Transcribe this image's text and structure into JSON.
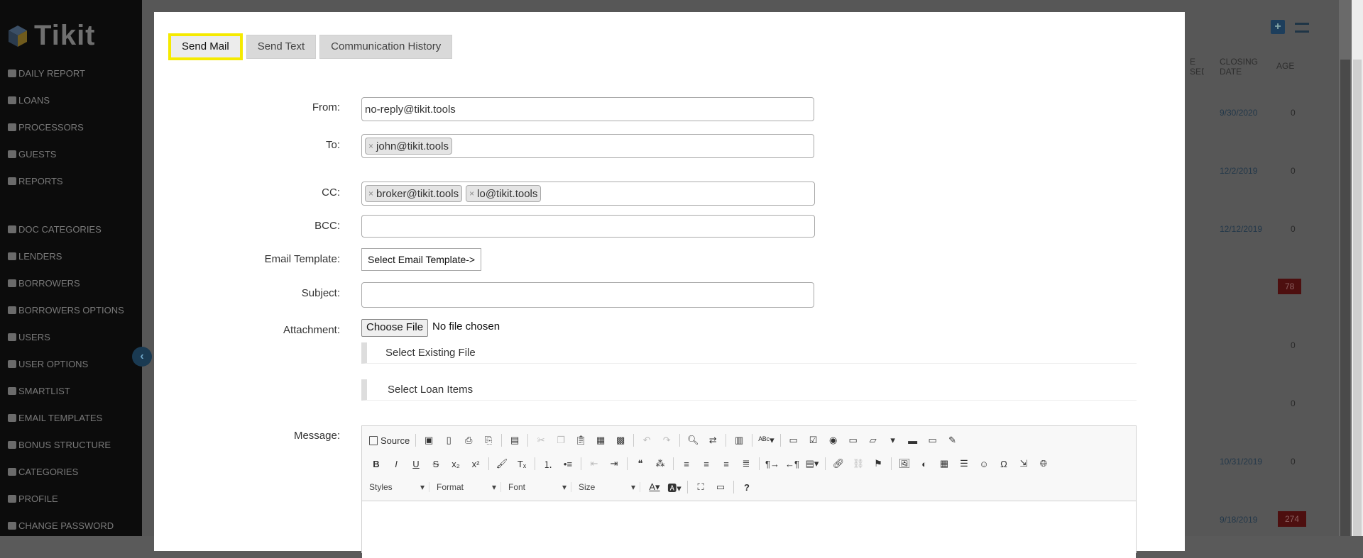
{
  "app": {
    "name": "Tikit"
  },
  "sidebar": {
    "items": [
      {
        "label": "DAILY REPORT",
        "icon": "list-icon"
      },
      {
        "label": "LOANS",
        "icon": "file-icon"
      },
      {
        "label": "PROCESSORS",
        "icon": "user-icon"
      },
      {
        "label": "GUESTS",
        "icon": "users-icon"
      },
      {
        "label": "REPORTS",
        "icon": "chart-icon"
      },
      {
        "label": "DOC CATEGORIES",
        "icon": "wrench-icon"
      },
      {
        "label": "LENDERS",
        "icon": "money-icon"
      },
      {
        "label": "BORROWERS",
        "icon": "home-icon"
      },
      {
        "label": "BORROWERS OPTIONS",
        "icon": "home-icon"
      },
      {
        "label": "USERS",
        "icon": "users-icon"
      },
      {
        "label": "USER OPTIONS",
        "icon": "user-tie-icon"
      },
      {
        "label": "SMARTLIST",
        "icon": "list-icon"
      },
      {
        "label": "EMAIL TEMPLATES",
        "icon": "envelope-icon"
      },
      {
        "label": "BONUS STRUCTURE",
        "icon": "money-icon"
      },
      {
        "label": "CATEGORIES",
        "icon": "wrench-icon"
      },
      {
        "label": "PROFILE",
        "icon": "user-icon"
      },
      {
        "label": "CHANGE PASSWORD",
        "icon": "key-icon"
      }
    ]
  },
  "background_table": {
    "headers": [
      "E SED",
      "CLOSING DATE",
      "AGE"
    ],
    "rows": [
      {
        "date": "9/30/2020",
        "age": "0"
      },
      {
        "date": "12/2/2019",
        "age": "0"
      },
      {
        "date": "12/12/2019",
        "age": "0"
      },
      {
        "date": "",
        "age": "78",
        "age_flag": "red"
      },
      {
        "date": "",
        "age": "0"
      },
      {
        "date": "",
        "age": "0"
      },
      {
        "date": "10/31/2019",
        "age": "0"
      },
      {
        "date": "9/18/2019",
        "age": "274",
        "age_flag": "red"
      }
    ]
  },
  "modal": {
    "tabs": [
      {
        "label": "Send Mail",
        "active": true
      },
      {
        "label": "Send Text",
        "active": false
      },
      {
        "label": "Communication History",
        "active": false
      }
    ],
    "form": {
      "from_label": "From:",
      "from_value": "no-reply@tikit.tools",
      "to_label": "To:",
      "to_chips": [
        "john@tikit.tools"
      ],
      "cc_label": "CC:",
      "cc_chips": [
        "broker@tikit.tools",
        "lo@tikit.tools"
      ],
      "bcc_label": "BCC:",
      "bcc_value": "",
      "template_label": "Email Template:",
      "template_value": "Select Email Template->",
      "subject_label": "Subject:",
      "subject_value": "",
      "attachment_label": "Attachment:",
      "choose_file": "Choose File",
      "no_file": "No file chosen",
      "select_existing": "Select Existing File",
      "select_loan_items": "Select Loan Items",
      "message_label": "Message:"
    },
    "editor": {
      "source_label": "Source",
      "styles": "Styles",
      "format": "Format",
      "font": "Font",
      "size": "Size"
    }
  },
  "colors": {
    "active_tab_border": "#f5ea00",
    "sidebar_bg": "#0c0c0c",
    "overlay_bg": "#575757"
  }
}
